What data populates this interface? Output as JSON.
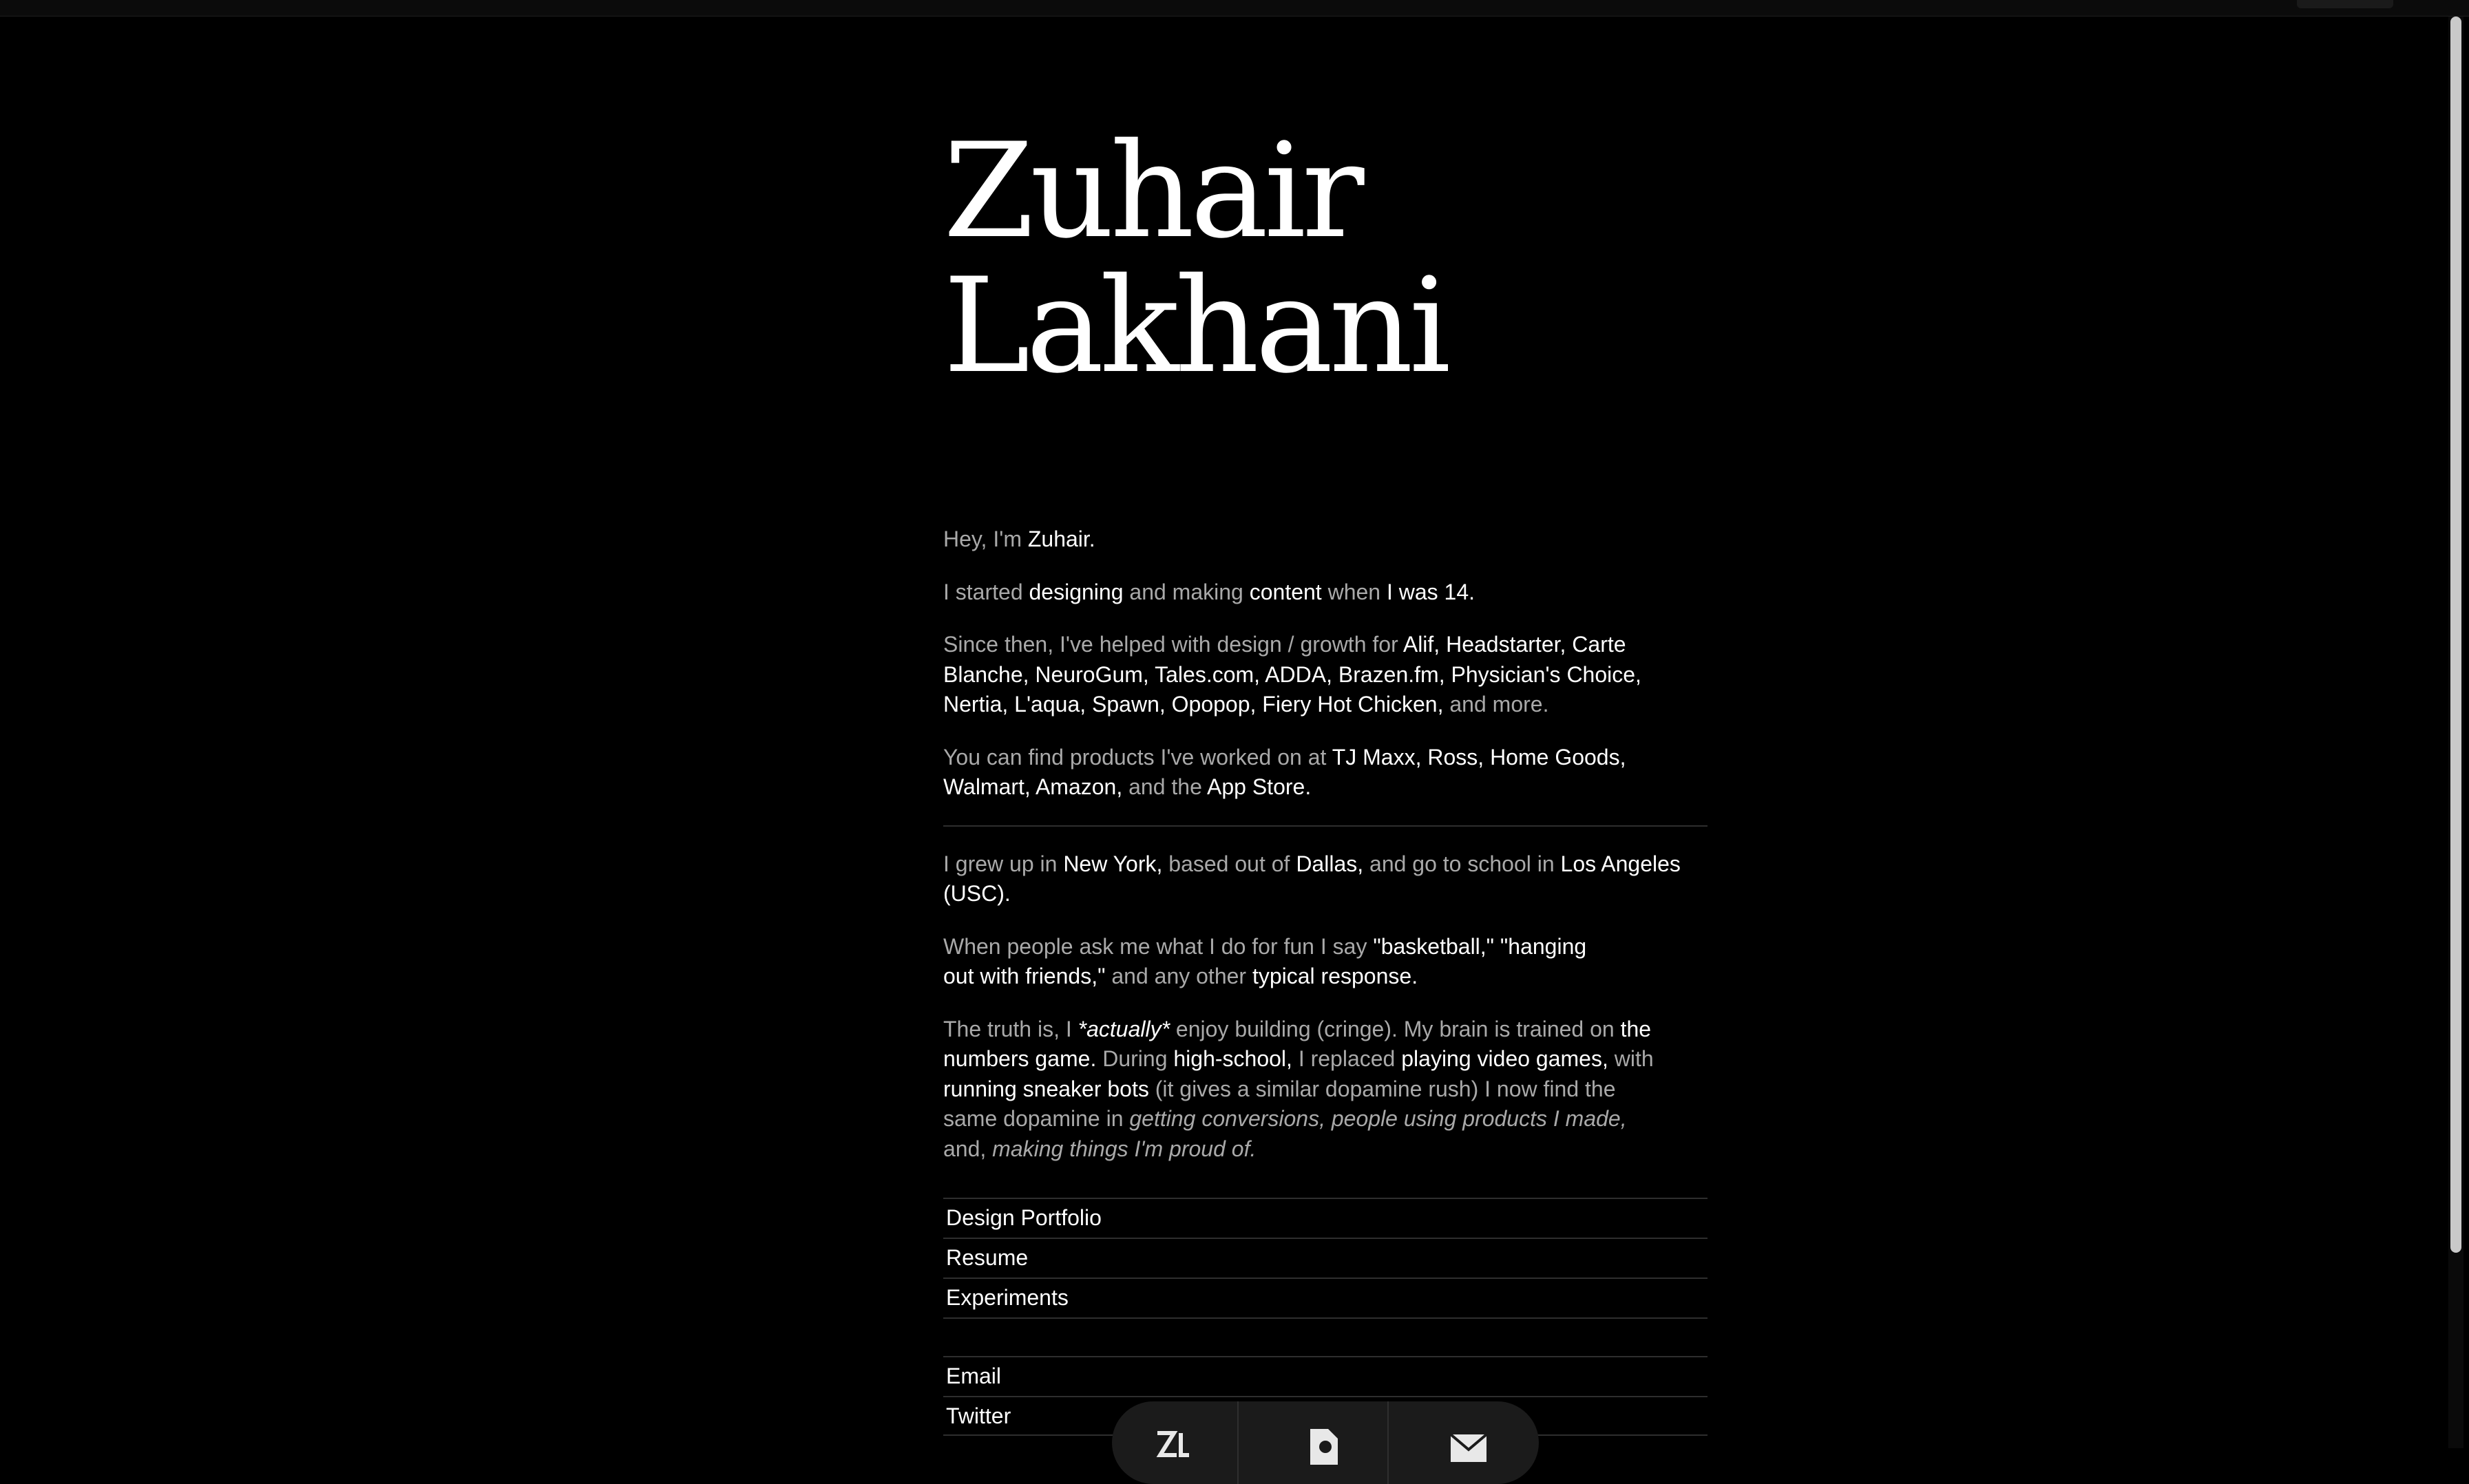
{
  "hero": {
    "first_name": "Zuhair",
    "last_name": "Lakhani"
  },
  "bio": {
    "p1": {
      "a": "Hey, I'm ",
      "name": "Zuhair.",
      "b": ""
    },
    "p2": {
      "a": "I started ",
      "designing": "designing",
      "b": " and making ",
      "content": "content",
      "c": " when ",
      "age": "I was 14."
    },
    "p3": {
      "a": "Since then, I've helped with design / growth for ",
      "clients": "Alif, Headstarter, Carte Blanche, NeuroGum, Tales.com, ADDA, Brazen.fm, Physician's Choice, Nertia, L'aqua, Spawn, Opopop, Fiery Hot Chicken,",
      "b": " and more."
    },
    "p4": {
      "a": "You can find products I've worked on at ",
      "stores": "TJ Maxx, Ross, Home Goods, Walmart, Amazon,",
      "b": " and the ",
      "app_store": "App Store."
    },
    "p5": {
      "a": "I grew up in ",
      "ny": "New York,",
      "b": " based out of ",
      "dallas": "Dallas,",
      "c": " and go to school in ",
      "la": "Los Angeles (USC)."
    },
    "p6": {
      "a": "When people ask me what I do for fun I say ",
      "quote": "\"basketball,\" \"hanging out with friends,\"",
      "b": " and any other ",
      "typical": "typical response."
    },
    "p7": {
      "a": "The truth is, I ",
      "actually": "*actually*",
      "b": " enjoy building (cringe). My brain is trained on ",
      "numbers": "the numbers game.",
      "c": " During ",
      "hs": "high-school,",
      "d": " I replaced ",
      "games": "playing video games,",
      "e": " with ",
      "bots": "running sneaker bots",
      "f": " (it gives a similar dopamine rush) I now find the same dopamine in ",
      "italic1": "getting conversions, people using products I made,",
      "g": " and, ",
      "italic2": "making things I'm proud of."
    }
  },
  "links": {
    "portfolio": "Design Portfolio",
    "resume": "Resume",
    "experiments": "Experiments",
    "email": "Email",
    "twitter": "Twitter"
  },
  "dock": {
    "icons": [
      "zl-logo-icon",
      "document-icon",
      "mail-icon"
    ]
  },
  "colors": {
    "background": "#000000",
    "text_dim": "#a9a9a9",
    "text_bright": "#ffffff",
    "divider": "#2e2e2e"
  }
}
